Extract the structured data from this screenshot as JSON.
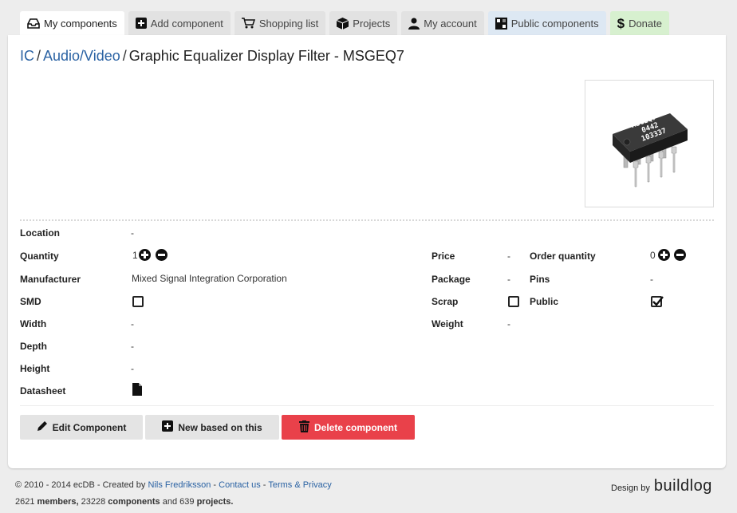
{
  "tabs": [
    {
      "label": "My components",
      "icon": "inbox-icon",
      "active": true
    },
    {
      "label": "Add component",
      "icon": "plus-square-icon"
    },
    {
      "label": "Shopping list",
      "icon": "cart-icon"
    },
    {
      "label": "Projects",
      "icon": "box-icon"
    },
    {
      "label": "My account",
      "icon": "user-icon"
    },
    {
      "label": "Public components",
      "icon": "grid-icon"
    },
    {
      "label": "Donate",
      "icon": "dollar-icon"
    }
  ],
  "breadcrumb": {
    "level1": "IC",
    "level2": "Audio/Video",
    "current": "Graphic Equalizer Display Filter - MSGEQ7",
    "separator": "/"
  },
  "photo": {
    "chip_lines": [
      "MSGEQ7",
      "0442",
      "103337"
    ]
  },
  "details": {
    "location": {
      "label": "Location",
      "value": "-"
    },
    "quantity": {
      "label": "Quantity",
      "value": "1"
    },
    "manufacturer": {
      "label": "Manufacturer",
      "value": "Mixed Signal Integration Corporation"
    },
    "smd": {
      "label": "SMD",
      "checked": false
    },
    "width": {
      "label": "Width",
      "value": "-"
    },
    "depth": {
      "label": "Depth",
      "value": "-"
    },
    "height": {
      "label": "Height",
      "value": "-"
    },
    "datasheet": {
      "label": "Datasheet",
      "icon": "file-icon"
    },
    "price": {
      "label": "Price",
      "value": "-"
    },
    "package": {
      "label": "Package",
      "value": "-"
    },
    "scrap": {
      "label": "Scrap",
      "checked": false
    },
    "weight": {
      "label": "Weight",
      "value": "-"
    },
    "order_quantity": {
      "label": "Order quantity",
      "value": "0"
    },
    "pins": {
      "label": "Pins",
      "value": "-"
    },
    "public": {
      "label": "Public",
      "checked": true
    }
  },
  "actions": {
    "edit": "Edit Component",
    "new_based": "New based on this",
    "delete": "Delete component"
  },
  "colors": {
    "link": "#2a62a3",
    "danger": "#e9414a",
    "donate_tab": "#d7f0cf",
    "public_tab": "#dde8f3"
  },
  "footer": {
    "copyright": "© 2010 - 2014 ecDB - Created by",
    "author": "Nils Fredriksson",
    "dash1": "-",
    "contact": "Contact us",
    "dash2": "-",
    "terms": "Terms & Privacy",
    "members_count": "2621",
    "members_label": "members,",
    "components_count": "23228",
    "components_label": "components",
    "and_text": "and",
    "projects_count": "639",
    "projects_label": "projects.",
    "design_by": "Design by",
    "design_logo": "buildlog"
  }
}
